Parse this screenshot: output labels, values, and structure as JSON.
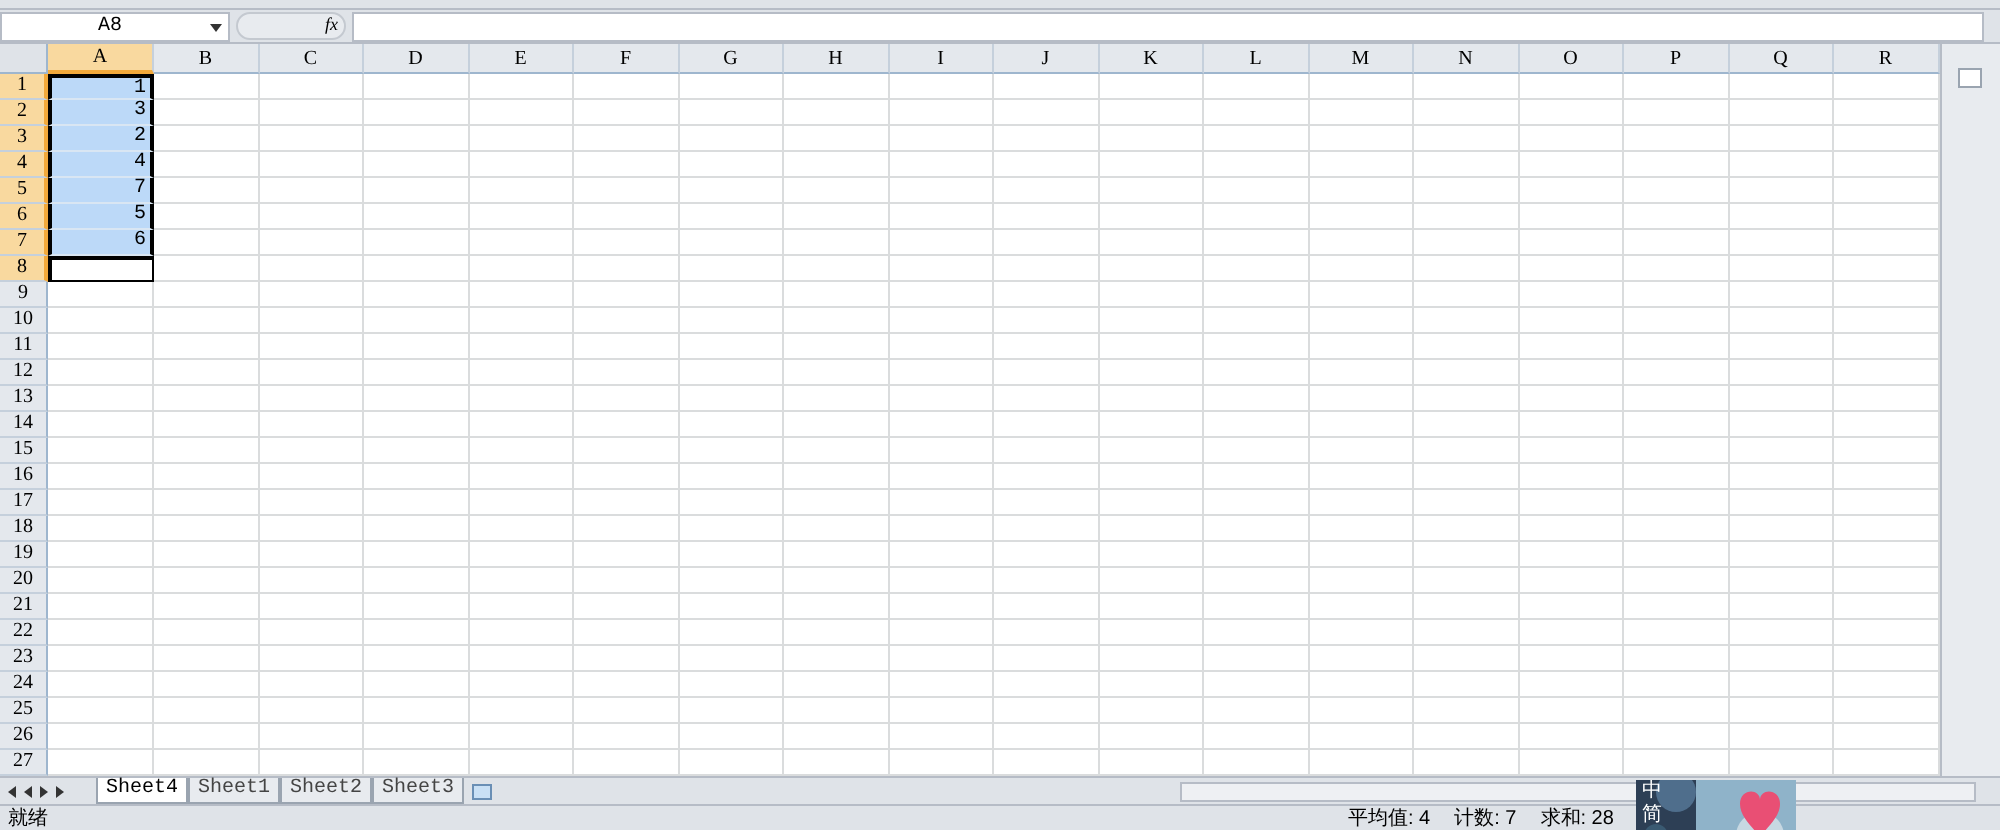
{
  "formula_bar": {
    "name_box": "A8",
    "fx": "fx"
  },
  "columns": [
    {
      "label": "A",
      "selected": true
    },
    {
      "label": "B",
      "selected": false
    },
    {
      "label": "C",
      "selected": false
    },
    {
      "label": "D",
      "selected": false
    },
    {
      "label": "E",
      "selected": false
    },
    {
      "label": "F",
      "selected": false
    },
    {
      "label": "G",
      "selected": false
    },
    {
      "label": "H",
      "selected": false
    },
    {
      "label": "I",
      "selected": false
    },
    {
      "label": "J",
      "selected": false
    },
    {
      "label": "K",
      "selected": false
    },
    {
      "label": "L",
      "selected": false
    },
    {
      "label": "M",
      "selected": false
    },
    {
      "label": "N",
      "selected": false
    },
    {
      "label": "O",
      "selected": false
    },
    {
      "label": "P",
      "selected": false
    },
    {
      "label": "Q",
      "selected": false
    },
    {
      "label": "R",
      "selected": false
    }
  ],
  "rows": [
    {
      "header": "1",
      "selected": true,
      "cells": [
        "1"
      ]
    },
    {
      "header": "2",
      "selected": true,
      "cells": [
        "3"
      ]
    },
    {
      "header": "3",
      "selected": true,
      "cells": [
        "2"
      ]
    },
    {
      "header": "4",
      "selected": true,
      "cells": [
        "4"
      ]
    },
    {
      "header": "5",
      "selected": true,
      "cells": [
        "7"
      ]
    },
    {
      "header": "6",
      "selected": true,
      "cells": [
        "5"
      ]
    },
    {
      "header": "7",
      "selected": true,
      "cells": [
        "6"
      ]
    },
    {
      "header": "8",
      "selected": true,
      "active": true,
      "cells": []
    },
    {
      "header": "9",
      "selected": false,
      "cells": []
    },
    {
      "header": "10",
      "selected": false,
      "cells": []
    },
    {
      "header": "11",
      "selected": false,
      "cells": []
    },
    {
      "header": "12",
      "selected": false,
      "cells": []
    },
    {
      "header": "13",
      "selected": false,
      "cells": []
    },
    {
      "header": "14",
      "selected": false,
      "cells": []
    },
    {
      "header": "15",
      "selected": false,
      "cells": []
    },
    {
      "header": "16",
      "selected": false,
      "cells": []
    },
    {
      "header": "17",
      "selected": false,
      "cells": []
    },
    {
      "header": "18",
      "selected": false,
      "cells": []
    },
    {
      "header": "19",
      "selected": false,
      "cells": []
    },
    {
      "header": "20",
      "selected": false,
      "cells": []
    },
    {
      "header": "21",
      "selected": false,
      "cells": []
    },
    {
      "header": "22",
      "selected": false,
      "cells": []
    },
    {
      "header": "23",
      "selected": false,
      "cells": []
    },
    {
      "header": "24",
      "selected": false,
      "cells": []
    },
    {
      "header": "25",
      "selected": false,
      "cells": []
    },
    {
      "header": "26",
      "selected": false,
      "cells": []
    },
    {
      "header": "27",
      "selected": false,
      "cells": []
    }
  ],
  "sheet_tabs": [
    {
      "label": "Sheet4",
      "selected": true
    },
    {
      "label": "Sheet1",
      "selected": false
    },
    {
      "label": "Sheet2",
      "selected": false
    },
    {
      "label": "Sheet3",
      "selected": false
    }
  ],
  "status_bar": {
    "mode": "就绪",
    "stats": [
      "平均值: 4",
      "计数: 7",
      "求和: 28"
    ]
  },
  "ime_toolbar": {
    "labels": [
      "中",
      "简"
    ]
  }
}
